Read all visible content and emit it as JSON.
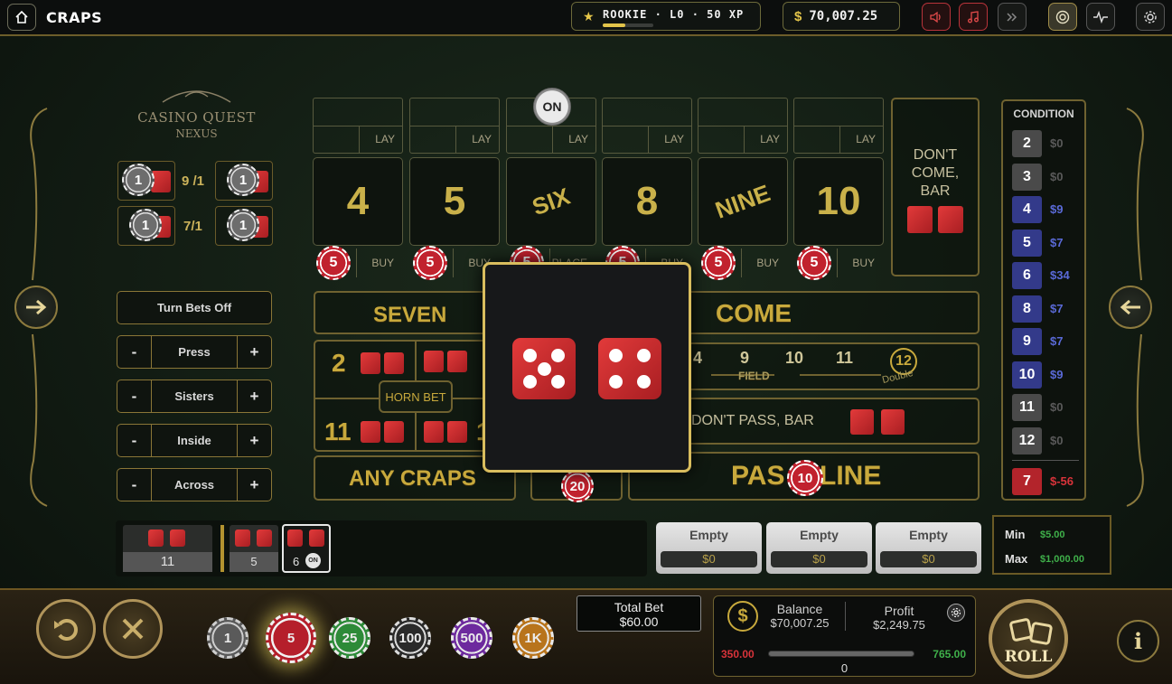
{
  "topbar": {
    "title": "CRAPS",
    "rank": "ROOKIE · L0 · 50 XP",
    "rank_progress": 0.45,
    "balance_symbol": "$",
    "balance": "70,007.25"
  },
  "logo": {
    "line1": "CASINO QUEST",
    "line2": "NEXUS"
  },
  "hop_bets": {
    "odds_top": "9 /1",
    "odds_bottom": "7/1",
    "chip_value": "1"
  },
  "controls": {
    "turn_bets_off": "Turn Bets Off",
    "press": "Press",
    "sisters": "Sisters",
    "inside": "Inside",
    "across": "Across",
    "minus": "-",
    "plus": "+"
  },
  "board": {
    "puck": "ON",
    "lay_label": "LAY",
    "buy_label": "BUY",
    "place_label": "PLACE",
    "numbers": [
      {
        "label": "4"
      },
      {
        "label": "5"
      },
      {
        "label": "SIX"
      },
      {
        "label": "8"
      },
      {
        "label": "NINE"
      },
      {
        "label": "10"
      }
    ],
    "buy_chip_value": "5",
    "dont_come": "DON'T COME, BAR",
    "come": "COME",
    "field_label": "FIELD",
    "field_numbers": [
      "4",
      "9",
      "10",
      "11"
    ],
    "field_12": "12",
    "field_double": "Double",
    "seven": "SEVEN",
    "prop_2": "2",
    "prop_11": "11",
    "prop_1": "1",
    "horn_bet": "HORN BET",
    "any_craps": "ANY CRAPS",
    "any_craps_chip": "20",
    "dont_pass": "DON'T PASS, BAR",
    "pass_line_left": "PAS",
    "pass_line_right": "LINE",
    "pass_line_chip": "10"
  },
  "dice_result": {
    "die1": 5,
    "die2": 4
  },
  "condition": {
    "header": "CONDITION",
    "rows": [
      {
        "n": "2",
        "v": "$0",
        "active": false
      },
      {
        "n": "3",
        "v": "$0",
        "active": false
      },
      {
        "n": "4",
        "v": "$9",
        "active": true
      },
      {
        "n": "5",
        "v": "$7",
        "active": true
      },
      {
        "n": "6",
        "v": "$34",
        "active": true
      },
      {
        "n": "8",
        "v": "$7",
        "active": true
      },
      {
        "n": "9",
        "v": "$7",
        "active": true
      },
      {
        "n": "10",
        "v": "$9",
        "active": true
      },
      {
        "n": "11",
        "v": "$0",
        "active": false
      },
      {
        "n": "12",
        "v": "$0",
        "active": false
      }
    ],
    "seven": {
      "n": "7",
      "v": "$-56"
    }
  },
  "history": [
    {
      "total": "11"
    },
    {
      "total": "5"
    },
    {
      "total": "6",
      "badge": "ON"
    }
  ],
  "empty_slots": [
    {
      "title": "Empty",
      "value": "$0"
    },
    {
      "title": "Empty",
      "value": "$0"
    },
    {
      "title": "Empty",
      "value": "$0"
    }
  ],
  "limits": {
    "min_label": "Min",
    "min": "$5.00",
    "max_label": "Max",
    "max": "$1,000.00"
  },
  "footer": {
    "chips": [
      "1",
      "5",
      "25",
      "100",
      "500",
      "1K"
    ],
    "total_bet_label": "Total Bet",
    "total_bet": "$60.00",
    "balance_label": "Balance",
    "balance": "$70,007.25",
    "profit_label": "Profit",
    "profit": "$2,249.75",
    "range_low": "350.00",
    "range_high": "765.00",
    "range_value": "0",
    "roll": "ROLL"
  }
}
